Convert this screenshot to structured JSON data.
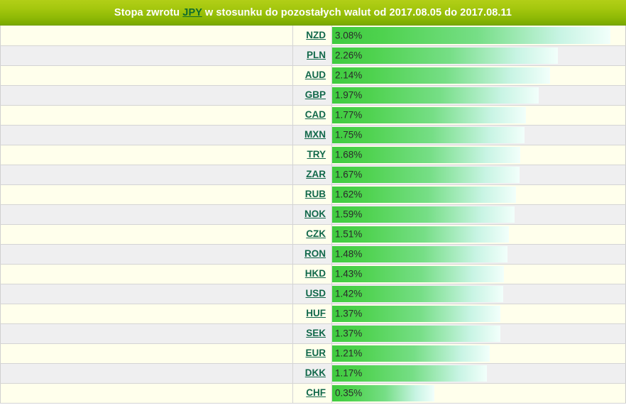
{
  "header": {
    "title_prefix": "Stopa zwrotu ",
    "base_currency": "JPY",
    "title_suffix": " w stosunku do pozostałych walut od 2017.08.05 do 2017.08.11",
    "full_title": "Stopa zwrotu JPY w stosunku do pozostałych walut od 2017.08.05 do 2017.08.11",
    "date_from": "2017.08.05",
    "date_to": "2017.08.11"
  },
  "colors": {
    "header_gradient_top": "#b2cf17",
    "header_gradient_bottom": "#79a900",
    "header_text": "#ffffff",
    "link_green": "#0d6b2e",
    "code_link": "#11684a",
    "bar_start": "#3fcb3f",
    "bar_end": "#f2fffb",
    "row_odd_bg": "#ffffec",
    "row_even_bg": "#efeff0",
    "border": "#d4d4d4",
    "value_text": "#2a2a2a"
  },
  "chart_data": {
    "type": "bar",
    "title": "Stopa zwrotu JPY w stosunku do pozostałych walut od 2017.08.05 do 2017.08.11",
    "xlabel": "",
    "ylabel": "",
    "orientation": "horizontal",
    "grid": false,
    "legend": "none",
    "unit": "%",
    "xlim": [
      0,
      3.08
    ],
    "categories": [
      "NZD",
      "PLN",
      "AUD",
      "GBP",
      "CAD",
      "MXN",
      "TRY",
      "ZAR",
      "RUB",
      "NOK",
      "CZK",
      "RON",
      "HKD",
      "USD",
      "HUF",
      "SEK",
      "EUR",
      "DKK",
      "CHF"
    ],
    "values": [
      3.08,
      2.26,
      2.14,
      1.97,
      1.77,
      1.75,
      1.68,
      1.67,
      1.62,
      1.59,
      1.51,
      1.48,
      1.43,
      1.42,
      1.37,
      1.37,
      1.21,
      1.17,
      0.35
    ],
    "labels": [
      "3.08%",
      "2.26%",
      "2.14%",
      "1.97%",
      "1.77%",
      "1.75%",
      "1.68%",
      "1.67%",
      "1.62%",
      "1.59%",
      "1.51%",
      "1.48%",
      "1.43%",
      "1.42%",
      "1.37%",
      "1.37%",
      "1.21%",
      "1.17%",
      "0.35%"
    ]
  },
  "rows": [
    {
      "code": "NZD",
      "value": 3.08,
      "label": "3.08%"
    },
    {
      "code": "PLN",
      "value": 2.26,
      "label": "2.26%"
    },
    {
      "code": "AUD",
      "value": 2.14,
      "label": "2.14%"
    },
    {
      "code": "GBP",
      "value": 1.97,
      "label": "1.97%"
    },
    {
      "code": "CAD",
      "value": 1.77,
      "label": "1.77%"
    },
    {
      "code": "MXN",
      "value": 1.75,
      "label": "1.75%"
    },
    {
      "code": "TRY",
      "value": 1.68,
      "label": "1.68%"
    },
    {
      "code": "ZAR",
      "value": 1.67,
      "label": "1.67%"
    },
    {
      "code": "RUB",
      "value": 1.62,
      "label": "1.62%"
    },
    {
      "code": "NOK",
      "value": 1.59,
      "label": "1.59%"
    },
    {
      "code": "CZK",
      "value": 1.51,
      "label": "1.51%"
    },
    {
      "code": "RON",
      "value": 1.48,
      "label": "1.48%"
    },
    {
      "code": "HKD",
      "value": 1.43,
      "label": "1.43%"
    },
    {
      "code": "USD",
      "value": 1.42,
      "label": "1.42%"
    },
    {
      "code": "HUF",
      "value": 1.37,
      "label": "1.37%"
    },
    {
      "code": "SEK",
      "value": 1.37,
      "label": "1.37%"
    },
    {
      "code": "EUR",
      "value": 1.21,
      "label": "1.21%"
    },
    {
      "code": "DKK",
      "value": 1.17,
      "label": "1.17%"
    },
    {
      "code": "CHF",
      "value": 0.35,
      "label": "0.35%"
    }
  ]
}
